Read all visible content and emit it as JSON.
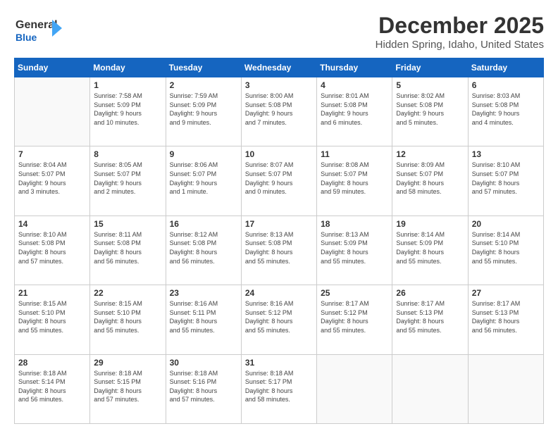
{
  "header": {
    "logo_general": "General",
    "logo_blue": "Blue",
    "title": "December 2025",
    "subtitle": "Hidden Spring, Idaho, United States"
  },
  "calendar": {
    "days_of_week": [
      "Sunday",
      "Monday",
      "Tuesday",
      "Wednesday",
      "Thursday",
      "Friday",
      "Saturday"
    ],
    "weeks": [
      [
        {
          "day": "",
          "info": ""
        },
        {
          "day": "1",
          "info": "Sunrise: 7:58 AM\nSunset: 5:09 PM\nDaylight: 9 hours\nand 10 minutes."
        },
        {
          "day": "2",
          "info": "Sunrise: 7:59 AM\nSunset: 5:09 PM\nDaylight: 9 hours\nand 9 minutes."
        },
        {
          "day": "3",
          "info": "Sunrise: 8:00 AM\nSunset: 5:08 PM\nDaylight: 9 hours\nand 7 minutes."
        },
        {
          "day": "4",
          "info": "Sunrise: 8:01 AM\nSunset: 5:08 PM\nDaylight: 9 hours\nand 6 minutes."
        },
        {
          "day": "5",
          "info": "Sunrise: 8:02 AM\nSunset: 5:08 PM\nDaylight: 9 hours\nand 5 minutes."
        },
        {
          "day": "6",
          "info": "Sunrise: 8:03 AM\nSunset: 5:08 PM\nDaylight: 9 hours\nand 4 minutes."
        }
      ],
      [
        {
          "day": "7",
          "info": "Sunrise: 8:04 AM\nSunset: 5:07 PM\nDaylight: 9 hours\nand 3 minutes."
        },
        {
          "day": "8",
          "info": "Sunrise: 8:05 AM\nSunset: 5:07 PM\nDaylight: 9 hours\nand 2 minutes."
        },
        {
          "day": "9",
          "info": "Sunrise: 8:06 AM\nSunset: 5:07 PM\nDaylight: 9 hours\nand 1 minute."
        },
        {
          "day": "10",
          "info": "Sunrise: 8:07 AM\nSunset: 5:07 PM\nDaylight: 9 hours\nand 0 minutes."
        },
        {
          "day": "11",
          "info": "Sunrise: 8:08 AM\nSunset: 5:07 PM\nDaylight: 8 hours\nand 59 minutes."
        },
        {
          "day": "12",
          "info": "Sunrise: 8:09 AM\nSunset: 5:07 PM\nDaylight: 8 hours\nand 58 minutes."
        },
        {
          "day": "13",
          "info": "Sunrise: 8:10 AM\nSunset: 5:07 PM\nDaylight: 8 hours\nand 57 minutes."
        }
      ],
      [
        {
          "day": "14",
          "info": "Sunrise: 8:10 AM\nSunset: 5:08 PM\nDaylight: 8 hours\nand 57 minutes."
        },
        {
          "day": "15",
          "info": "Sunrise: 8:11 AM\nSunset: 5:08 PM\nDaylight: 8 hours\nand 56 minutes."
        },
        {
          "day": "16",
          "info": "Sunrise: 8:12 AM\nSunset: 5:08 PM\nDaylight: 8 hours\nand 56 minutes."
        },
        {
          "day": "17",
          "info": "Sunrise: 8:13 AM\nSunset: 5:08 PM\nDaylight: 8 hours\nand 55 minutes."
        },
        {
          "day": "18",
          "info": "Sunrise: 8:13 AM\nSunset: 5:09 PM\nDaylight: 8 hours\nand 55 minutes."
        },
        {
          "day": "19",
          "info": "Sunrise: 8:14 AM\nSunset: 5:09 PM\nDaylight: 8 hours\nand 55 minutes."
        },
        {
          "day": "20",
          "info": "Sunrise: 8:14 AM\nSunset: 5:10 PM\nDaylight: 8 hours\nand 55 minutes."
        }
      ],
      [
        {
          "day": "21",
          "info": "Sunrise: 8:15 AM\nSunset: 5:10 PM\nDaylight: 8 hours\nand 55 minutes."
        },
        {
          "day": "22",
          "info": "Sunrise: 8:15 AM\nSunset: 5:10 PM\nDaylight: 8 hours\nand 55 minutes."
        },
        {
          "day": "23",
          "info": "Sunrise: 8:16 AM\nSunset: 5:11 PM\nDaylight: 8 hours\nand 55 minutes."
        },
        {
          "day": "24",
          "info": "Sunrise: 8:16 AM\nSunset: 5:12 PM\nDaylight: 8 hours\nand 55 minutes."
        },
        {
          "day": "25",
          "info": "Sunrise: 8:17 AM\nSunset: 5:12 PM\nDaylight: 8 hours\nand 55 minutes."
        },
        {
          "day": "26",
          "info": "Sunrise: 8:17 AM\nSunset: 5:13 PM\nDaylight: 8 hours\nand 55 minutes."
        },
        {
          "day": "27",
          "info": "Sunrise: 8:17 AM\nSunset: 5:13 PM\nDaylight: 8 hours\nand 56 minutes."
        }
      ],
      [
        {
          "day": "28",
          "info": "Sunrise: 8:18 AM\nSunset: 5:14 PM\nDaylight: 8 hours\nand 56 minutes."
        },
        {
          "day": "29",
          "info": "Sunrise: 8:18 AM\nSunset: 5:15 PM\nDaylight: 8 hours\nand 57 minutes."
        },
        {
          "day": "30",
          "info": "Sunrise: 8:18 AM\nSunset: 5:16 PM\nDaylight: 8 hours\nand 57 minutes."
        },
        {
          "day": "31",
          "info": "Sunrise: 8:18 AM\nSunset: 5:17 PM\nDaylight: 8 hours\nand 58 minutes."
        },
        {
          "day": "",
          "info": ""
        },
        {
          "day": "",
          "info": ""
        },
        {
          "day": "",
          "info": ""
        }
      ]
    ]
  }
}
